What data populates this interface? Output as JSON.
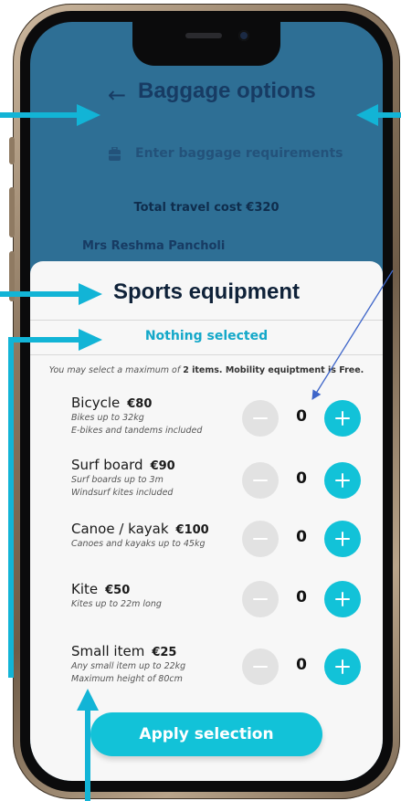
{
  "header": {
    "back_icon": "arrow-left-icon",
    "title": "Baggage options"
  },
  "baggage_requirements": {
    "icon": "luggage-icon",
    "label": "Enter baggage requirements"
  },
  "total_cost": "Total travel cost €320",
  "passenger_name": "Mrs Reshma Pancholi",
  "sheet": {
    "title": "Sports equipment",
    "selection_status": "Nothing selected",
    "note_prefix": "You may select a maximum of ",
    "note_bold": "2 items. Mobility equiptment is Free."
  },
  "items": [
    {
      "name": "Bicycle",
      "price": "€80",
      "desc1": "Bikes up to 32kg",
      "desc2": "E-bikes and tandems included",
      "qty": "0"
    },
    {
      "name": "Surf board",
      "price": "€90",
      "desc1": "Surf boards up to 3m",
      "desc2": "Windsurf kites included",
      "qty": "0"
    },
    {
      "name": "Canoe / kayak",
      "price": "€100",
      "desc1": "Canoes and kayaks up to 45kg",
      "desc2": "",
      "qty": "0"
    },
    {
      "name": "Kite",
      "price": "€50",
      "desc1": "Kites up to 22m long",
      "desc2": "",
      "qty": "0"
    },
    {
      "name": "Small item",
      "price": "€25",
      "desc1": "Any small item up to 22kg",
      "desc2": "Maximum height of 80cm",
      "qty": "0"
    }
  ],
  "apply_label": "Apply selection",
  "colors": {
    "accent": "#12c2d8",
    "selection_text": "#14a8c9",
    "background_overlay": "#2e6f95",
    "title_navy": "#0f2239",
    "annotation_arrow": "#12b4d6"
  }
}
